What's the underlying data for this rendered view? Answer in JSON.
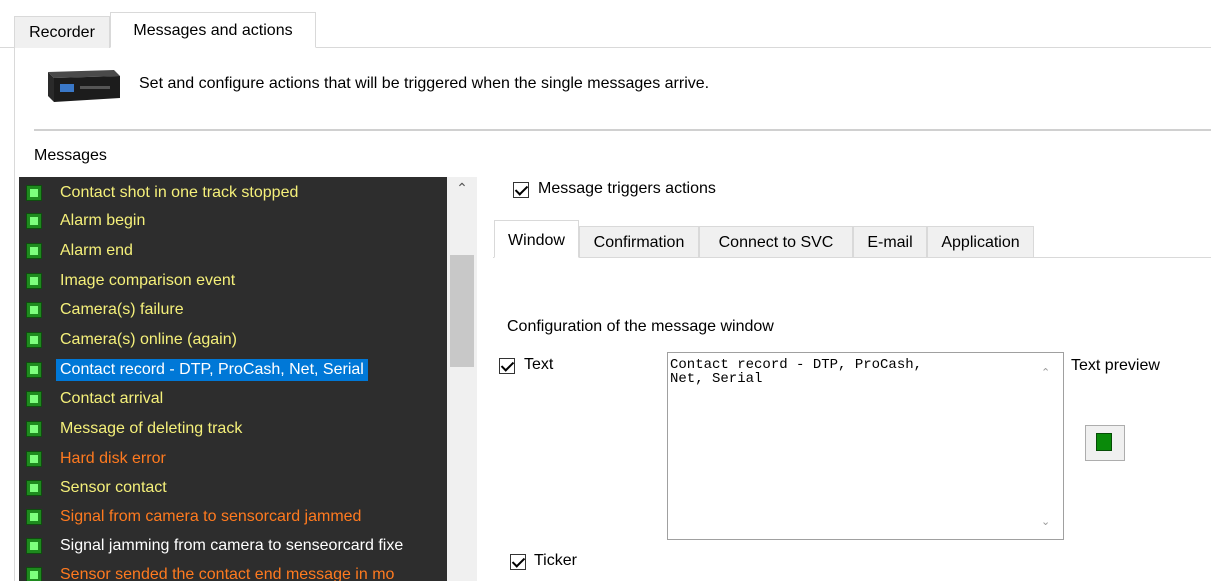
{
  "tabs": [
    {
      "label": "Recorder",
      "active": false
    },
    {
      "label": "Messages and actions",
      "active": true
    }
  ],
  "header": {
    "description": "Set and configure actions that will be triggered when the single messages arrive.",
    "device_icon": "recorder-device-icon"
  },
  "messages": {
    "label": "Messages",
    "items": [
      {
        "text": "Contact shot in one track stopped",
        "color": "#f5f07a"
      },
      {
        "text": "Alarm begin",
        "color": "#f5f07a"
      },
      {
        "text": "Alarm end",
        "color": "#f5f07a"
      },
      {
        "text": "Image comparison event",
        "color": "#f5f07a"
      },
      {
        "text": "Camera(s) failure",
        "color": "#f5f07a"
      },
      {
        "text": "Camera(s) online (again)",
        "color": "#f5f07a"
      },
      {
        "text": "Contact record - DTP, ProCash, Net, Serial",
        "color": "#ffffff",
        "selected": true
      },
      {
        "text": "Contact arrival",
        "color": "#f5f07a"
      },
      {
        "text": "Message of deleting track",
        "color": "#f5f07a"
      },
      {
        "text": "Hard disk error",
        "color": "#ff7a1f"
      },
      {
        "text": "Sensor contact",
        "color": "#f5f07a"
      },
      {
        "text": "Signal from camera to sensorcard jammed",
        "color": "#ff7a1f"
      },
      {
        "text": "Signal jamming from camera to senseorcard fixe",
        "color": "#ffffff"
      },
      {
        "text": "Sensor sended the contact end message in mo",
        "color": "#ff7a1f"
      }
    ]
  },
  "triggers": {
    "label": "Message triggers actions",
    "checked": true
  },
  "right_tabs": [
    {
      "label": "Window",
      "active": true
    },
    {
      "label": "Confirmation",
      "active": false
    },
    {
      "label": "Connect to SVC",
      "active": false
    },
    {
      "label": "E-mail",
      "active": false
    },
    {
      "label": "Application",
      "active": false
    }
  ],
  "window_config": {
    "title": "Configuration of the message window",
    "text_checkbox": {
      "label": "Text",
      "checked": true
    },
    "text_value": "Contact record - DTP, ProCash,\nNet, Serial",
    "text_preview_label": "Text preview",
    "ticker_checkbox": {
      "label": "Ticker",
      "checked": true
    },
    "color_button_icon": "green-square-icon"
  }
}
